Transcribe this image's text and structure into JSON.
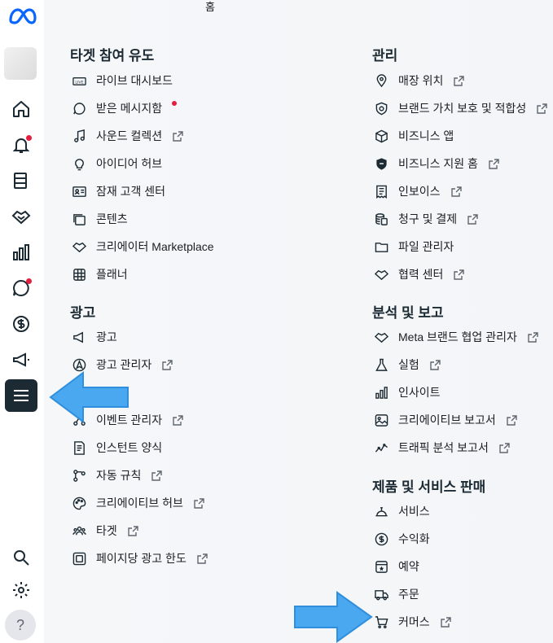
{
  "header": {
    "title": "홈"
  },
  "sidebar": {
    "accent": "#1c2b33",
    "notification_color": "#e41e3f",
    "help_label": "?"
  },
  "sections": {
    "engagement": {
      "title": "타겟 참여 유도",
      "items": [
        "라이브 대시보드",
        "받은 메시지함",
        "사운드 컬렉션",
        "아이디어 허브",
        "잠재 고객 센터",
        "콘텐츠",
        "크리에이터 Marketplace",
        "플래너"
      ]
    },
    "ads": {
      "title": "광고",
      "items": [
        "광고",
        "광고 관리자",
        "이벤트 관리자",
        "인스턴트 양식",
        "자동 규칙",
        "크리에이티브 허브",
        "타겟",
        "페이지당 광고 한도"
      ]
    },
    "manage": {
      "title": "관리",
      "items": [
        "매장 위치",
        "브랜드 가치 보호 및 적합성",
        "비즈니스 앱",
        "비즈니스 지원 홈",
        "인보이스",
        "청구 및 결제",
        "파일 관리자",
        "협력 센터"
      ]
    },
    "analytics": {
      "title": "분석 및 보고",
      "items": [
        "Meta 브랜드 협업 관리자",
        "실험",
        "인사이트",
        "크리에이티브 보고서",
        "트래픽 분석 보고서"
      ]
    },
    "commerce": {
      "title": "제품 및 서비스 판매",
      "items": [
        "서비스",
        "수익화",
        "예약",
        "주문",
        "커머스"
      ]
    }
  }
}
